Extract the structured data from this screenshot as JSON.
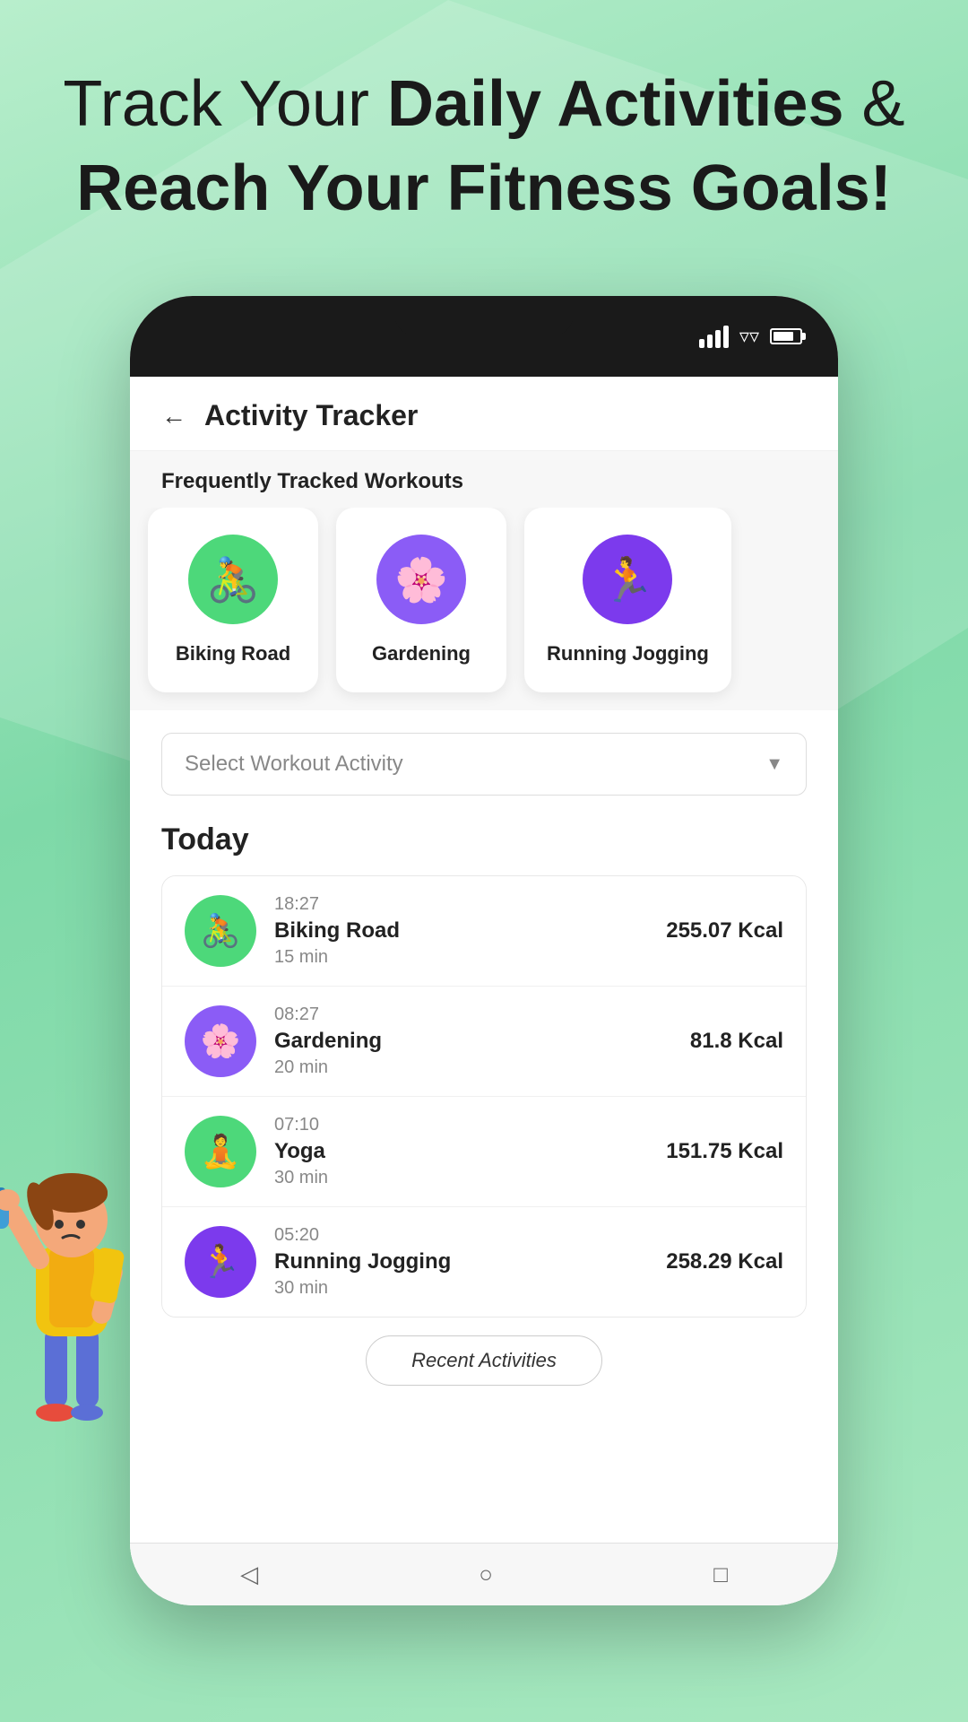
{
  "hero": {
    "line1_normal": "Track Your",
    "line1_bold": "Daily Activities",
    "line1_suffix": " &",
    "line2": "Reach Your Fitness Goals!"
  },
  "app": {
    "title": "Activity Tracker",
    "back_label": "←"
  },
  "frequently_tracked": {
    "section_label": "Frequently Tracked Workouts",
    "workouts": [
      {
        "name": "Biking Road",
        "bg_color": "#4dd87a",
        "emoji": "🚴"
      },
      {
        "name": "Gardening",
        "bg_color": "#8b5cf6",
        "emoji": "🌸"
      },
      {
        "name": "Running Jogging",
        "bg_color": "#7c3aed",
        "emoji": "🏃"
      }
    ]
  },
  "dropdown": {
    "placeholder": "Select Workout Activity",
    "arrow": "▼"
  },
  "today": {
    "header": "Today",
    "activities": [
      {
        "time": "18:27",
        "name": "Biking Road",
        "duration": "15 min",
        "calories": "255.07 Kcal",
        "bg_color": "#4dd87a",
        "emoji": "🚴"
      },
      {
        "time": "08:27",
        "name": "Gardening",
        "duration": "20 min",
        "calories": "81.8 Kcal",
        "bg_color": "#8b5cf6",
        "emoji": "🌸"
      },
      {
        "time": "07:10",
        "name": "Yoga",
        "duration": "30 min",
        "calories": "151.75 Kcal",
        "bg_color": "#4dd87a",
        "emoji": "🧘"
      },
      {
        "time": "05:20",
        "name": "Running Jogging",
        "duration": "30 min",
        "calories": "258.29 Kcal",
        "bg_color": "#7c3aed",
        "emoji": "🏃"
      }
    ]
  },
  "recent_btn": "Recent Activities",
  "nav": {
    "back": "◁",
    "home": "○",
    "square": "□"
  }
}
